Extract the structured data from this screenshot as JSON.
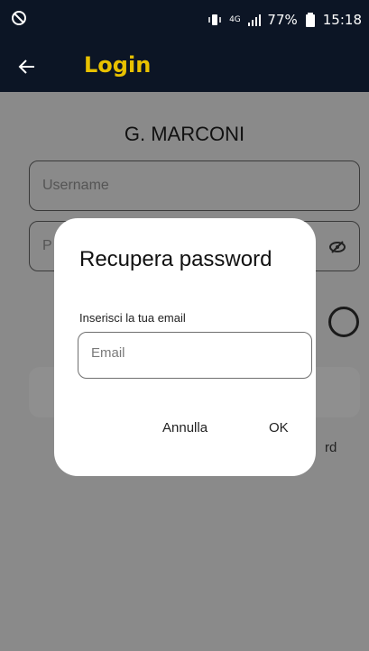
{
  "status_bar": {
    "battery": "77%",
    "time": "15:18",
    "network_label": "4G",
    "icons": [
      "do-not-disturb-icon",
      "vibrate-icon",
      "network-4g-icon",
      "signal-icon",
      "battery-icon"
    ]
  },
  "app_bar": {
    "title": "Login",
    "back_icon": "arrow-left-icon",
    "title_color": "#e8c100",
    "bar_color": "#0c1525"
  },
  "login": {
    "school_name": "G. MARCONI",
    "username_placeholder": "Username",
    "password_placeholder_partial": "P",
    "forgot_partial": "rd"
  },
  "dialog": {
    "title": "Recupera password",
    "email_label": "Inserisci la tua email",
    "email_placeholder": "Email",
    "email_value": "",
    "cancel_label": "Annulla",
    "ok_label": "OK"
  }
}
